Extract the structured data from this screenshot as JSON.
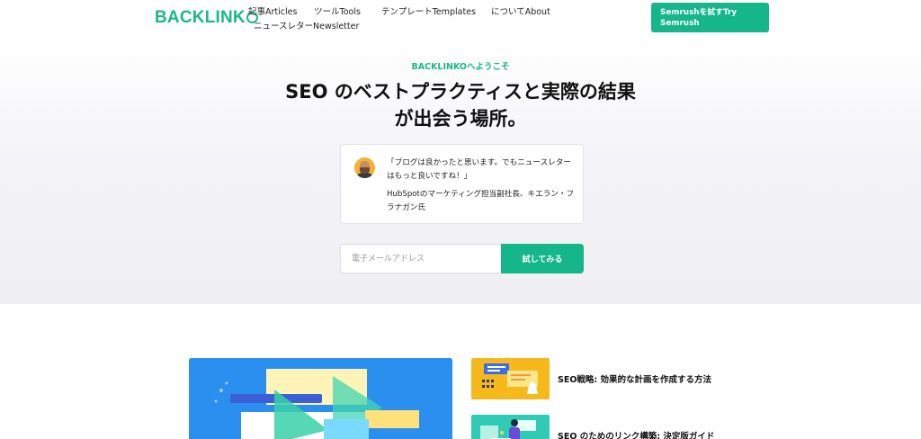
{
  "header": {
    "logo": "BACKLINK",
    "nav": [
      "記事Articles",
      "ツールTools",
      "テンプレートTemplates",
      "についてAbout",
      "ニュースレターNewsletter"
    ],
    "cta_label": "Semrushを試すTry Semrush"
  },
  "hero": {
    "eyebrow": "BACKLINKOへようこそ",
    "headline": "SEO のベストプラクティスと実際の結果が出会う場所。",
    "quote": "「ブログは良かったと思います。でもニュースレターはもっと良いですね！」",
    "author": "HubSpotのマーケティング担当副社長、キエラン・フラナガン氏",
    "email_placeholder": "電子メールアドレス",
    "button_label": "試してみる"
  },
  "articles": [
    {
      "title": "SEO戦略: 効果的な計画を作成する方法"
    },
    {
      "title": "SEO のためのリンク構築: 決定版ガイド"
    }
  ],
  "colors": {
    "brand_green": "#14b68a",
    "hero_bg": "#f1f1f5",
    "featured_blue": "#2b8ff0",
    "thumb_yellow": "#f6b91c",
    "thumb_teal": "#2fcbb4"
  },
  "icons": [
    "logo-o-icon",
    "avatar"
  ]
}
